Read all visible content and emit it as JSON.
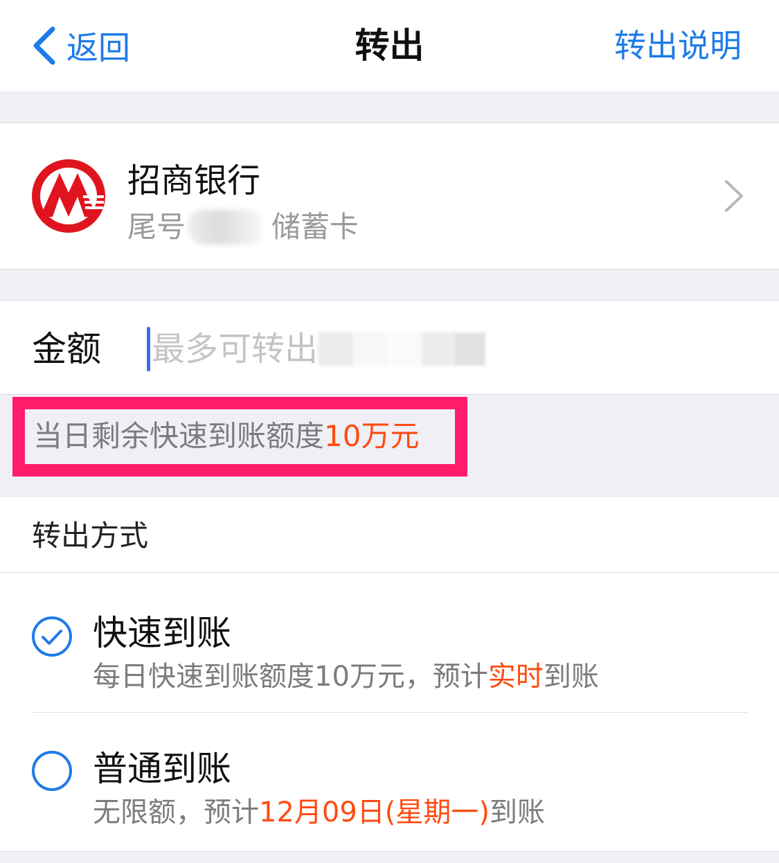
{
  "navbar": {
    "back_label": "返回",
    "title": "转出",
    "right_label": "转出说明"
  },
  "bank": {
    "name": "招商银行",
    "tail_prefix": "尾号",
    "card_type": "储蓄卡",
    "logo_color": "#e0141e"
  },
  "amount": {
    "label": "金额",
    "placeholder": "最多可转出"
  },
  "quota": {
    "text": "当日剩余快速到账额度",
    "value": "10万元"
  },
  "method": {
    "header": "转出方式",
    "options": [
      {
        "title": "快速到账",
        "checked": true,
        "desc_prefix": "每日快速到账额度10万元，预计",
        "desc_highlight": "实时",
        "desc_suffix": "到账"
      },
      {
        "title": "普通到账",
        "checked": false,
        "desc_prefix": "无限额，预计",
        "desc_highlight": "12月09日(星期一)",
        "desc_suffix": "到账"
      }
    ]
  },
  "colors": {
    "accent": "#1e7be8",
    "highlight": "#ff4b12",
    "annotation_border": "#ff1d6b"
  }
}
